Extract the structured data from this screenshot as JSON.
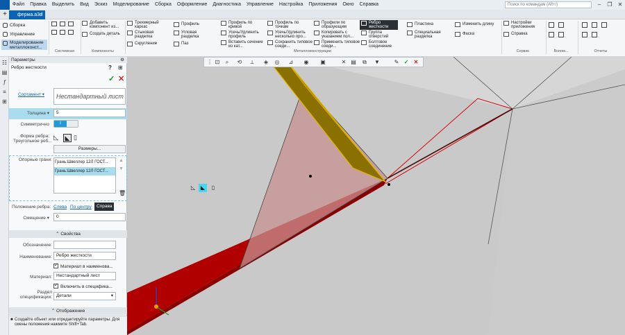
{
  "menu": {
    "items": [
      "Файл",
      "Правка",
      "Выделить",
      "Вид",
      "Эскиз",
      "Моделирование",
      "Сборка",
      "Оформление",
      "Диагностика",
      "Управление",
      "Настройка",
      "Приложения",
      "Окно",
      "Справка"
    ],
    "search_placeholder": "Поиск по командам (Alt+/)"
  },
  "tabs": {
    "document": "ферма.a3d"
  },
  "ribbon": {
    "modes": [
      "Сборка",
      "Управление",
      "Моделирование металлоконст..."
    ],
    "system_buttons_label": "Системная",
    "components": {
      "add": "Добавить компонент из...",
      "create": "Создать деталь",
      "label": "Компоненты"
    },
    "metal": {
      "frame3d": "Трехмерный каркас",
      "joint": "Стыковая разделка",
      "rounding": "Скругление",
      "profile": "Профиль",
      "corner_cut": "Угловая разделка",
      "groove": "Паз",
      "profile_curve": "Профиль по кривой",
      "extend_profile": "Усечь/Удлинить профиль",
      "insert_section": "Вставить сечение из кат...",
      "profile_points": "Профиль по точкам",
      "extend_several": "Усечь/Удлинить несколько про...",
      "save_joint": "Сохранить типовое соеди...",
      "profiles_generatrix": "Профили по образующим",
      "copy_with": "Копировать с указанием пол...",
      "apply_joint": "Применить типовое соеди...",
      "rib": "Ребро жесткости",
      "hole_group": "Группа отверстий",
      "bolt_joint": "Болтовое соединение",
      "plate": "Пластина",
      "special_cut": "Специальная разделка",
      "change_length": "Изменить длину",
      "chamfer": "Фаска",
      "label": "Металлоконструкции"
    },
    "service": {
      "settings": "Настройки приложения",
      "help": "Справка",
      "label": "Сервис"
    },
    "aux_label": "Вспом...",
    "reports_label": "Отчеты"
  },
  "panel": {
    "header": "Параметры",
    "title": "Ребро жесткости",
    "assortment_label": "Сортамент",
    "assortment_value": "Нестандартный лист",
    "thickness_label": "Толщина",
    "thickness_value": "5",
    "symmetric_label": "Симметрично",
    "rib_shape_label": "Форма ребра:",
    "rib_shape_value": "Треугольное реб...",
    "sizes_button": "Размеры...",
    "support_faces_label": "Опорные грани:",
    "support_faces": [
      "Грань:Швеллер  12Л ГОСТ...",
      "Грань:Швеллер  12Л ГОСТ..."
    ],
    "position_label": "Положение ребра:",
    "position_options": [
      "Слева",
      "По центру",
      "Справа"
    ],
    "offset_label": "Смещение",
    "offset_value": "0",
    "properties_section": "Свойства",
    "designation_label": "Обозначение:",
    "designation_value": "",
    "name_label": "Наименование:",
    "name_value": "Ребро жесткости",
    "material_in_name": "Материал в наименова...",
    "material_label": "Материал:",
    "material_value": "Нестандартный лист",
    "include_spec": "Включить в специфика...",
    "spec_section_label": "Раздел спецификации:",
    "spec_section_value": "Детали",
    "display_section": "Отображение",
    "hint": "Создайте объект или отредактируйте параметры. Для смены положения нажмите Shift+Tab."
  },
  "colors": {
    "accent": "#0b63b5",
    "beam_red": "#b30000",
    "rib_yellow": "#e1b400",
    "viewport": "#c9c9c9"
  }
}
